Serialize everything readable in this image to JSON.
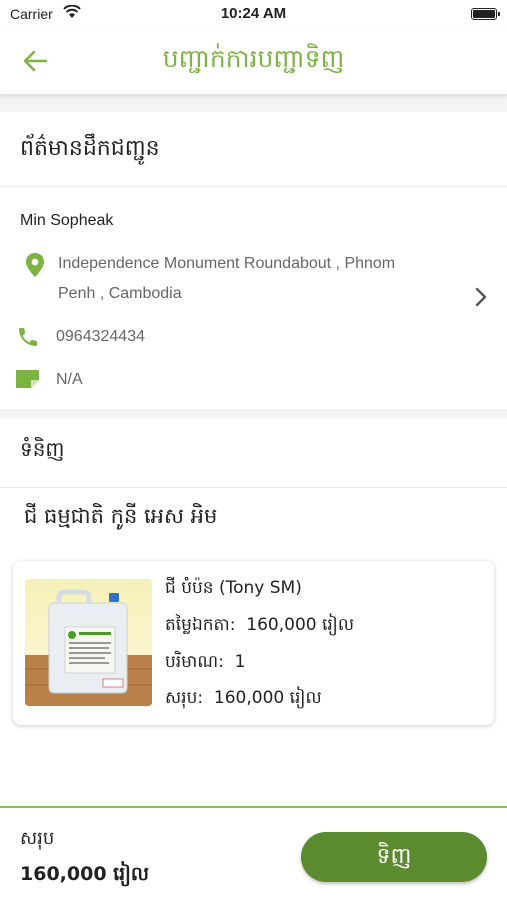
{
  "status_bar": {
    "carrier": "Carrier",
    "time": "10:24 AM"
  },
  "header": {
    "title": "បញ្ជាក់ការបញ្ជាទិញ"
  },
  "shipping": {
    "heading": "ព័ត៌មានដឹកជញ្ជូន",
    "name": "Min Sopheak",
    "address_line1": "Independence Monument Roundabout  , Phnom",
    "address_line2": "Penh , Cambodia",
    "phone": "0964324434",
    "note": "N/A"
  },
  "products": {
    "heading": "ទំនិញ",
    "shop_name": "ជី ធម្មជាតិ កូនី អេស អិម",
    "items": [
      {
        "name": "ជី បំប៉ន (Tony SM)",
        "price_label": "តម្លៃឯកតា:",
        "price": "160,000 រៀល",
        "qty_label": "បរិមាណ:",
        "qty": "1",
        "subtotal_label": "សរុប:",
        "subtotal": "160,000 រៀល"
      }
    ]
  },
  "footer": {
    "total_label": "សរុប",
    "total": "160,000 រៀល",
    "buy_label": "ទិញ"
  },
  "colors": {
    "accent": "#7cb342",
    "button": "#5c8a2e"
  }
}
